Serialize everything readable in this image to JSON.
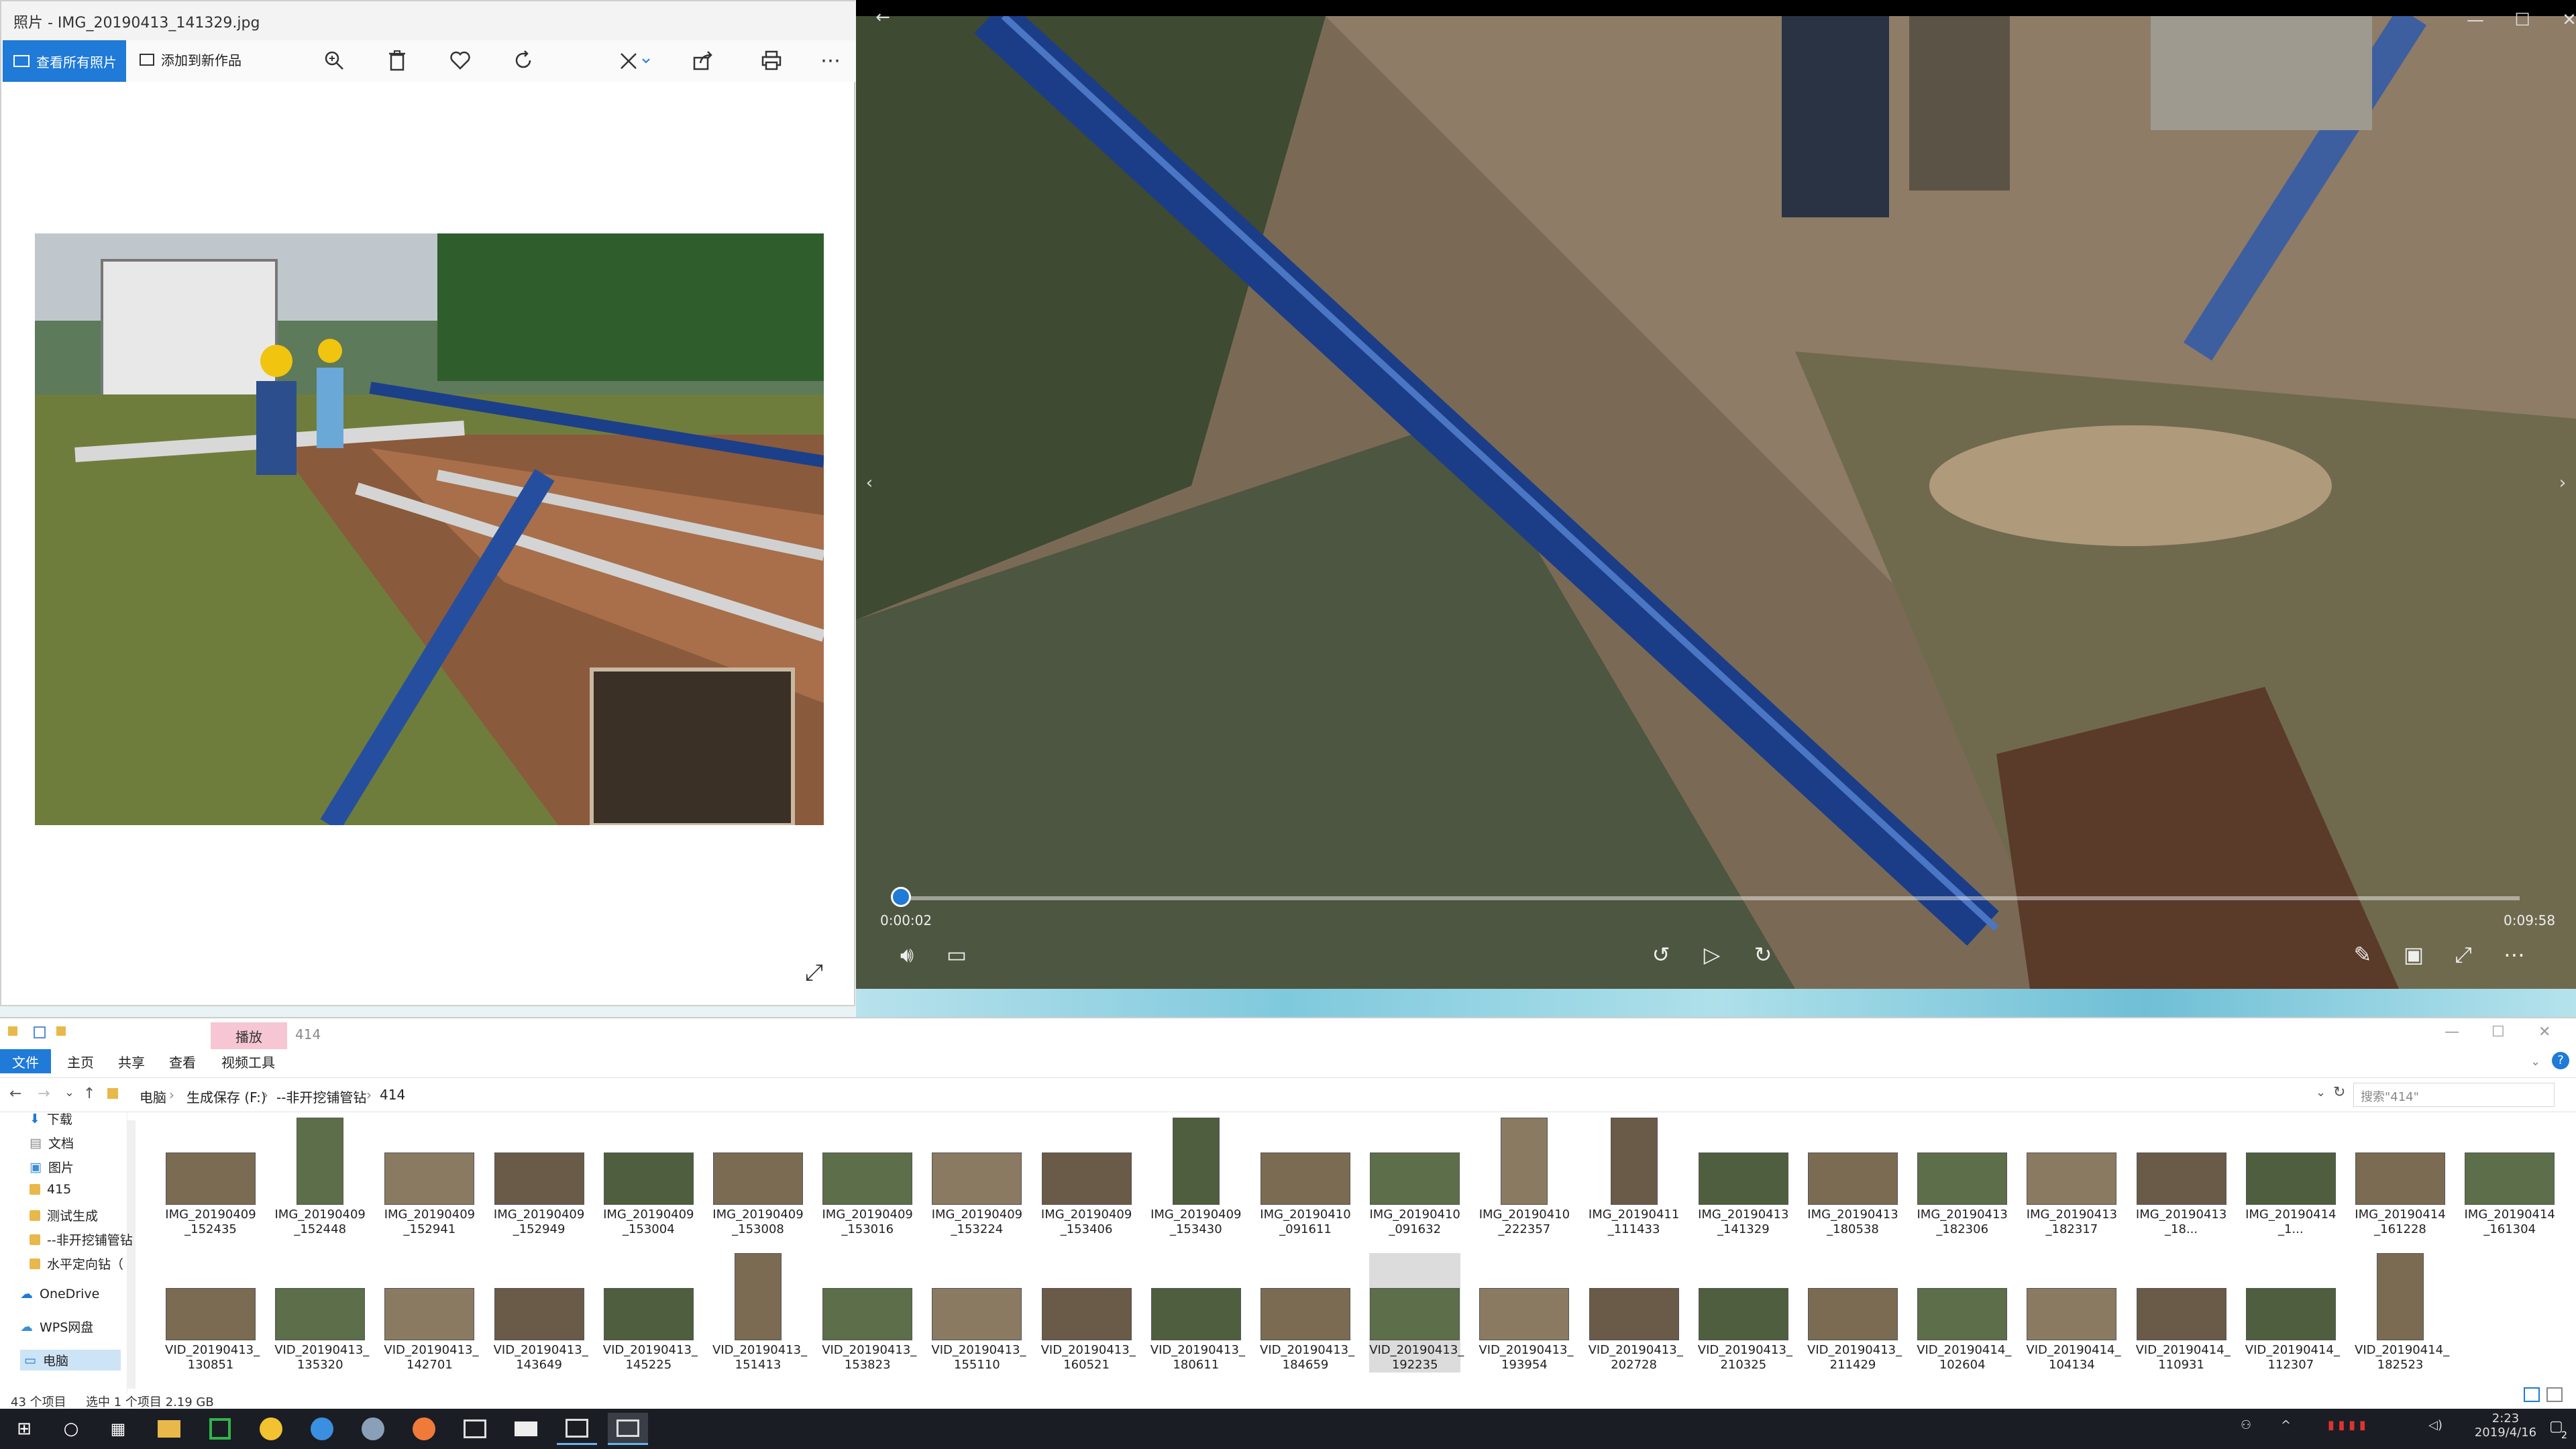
{
  "photos": {
    "title": "照片 - IMG_20190413_141329.jpg",
    "see_all_label": "查看所有照片",
    "add_to_creation_label": "添加到新作品"
  },
  "video": {
    "current_time": "0:00:02",
    "total_time": "0:09:58",
    "progress": 0.003
  },
  "explorer": {
    "context_tab": "播放",
    "folder_title": "414",
    "tabs": [
      "文件",
      "主页",
      "共享",
      "查看",
      "视频工具"
    ],
    "breadcrumb": [
      "电脑",
      "生成保存 (F:)",
      "--非开挖铺管钻",
      "414"
    ],
    "search_placeholder": "搜索\"414\"",
    "nav": {
      "quick": [
        "下载",
        "文档",
        "图片",
        "415",
        "测试生成",
        "--非开挖铺管钻",
        "水平定向钻（"
      ],
      "onedrive": "OneDrive",
      "wps": "WPS网盘",
      "pc": "电脑"
    },
    "row1": [
      {
        "l1": "IMG_20190409",
        "l2": "_152435"
      },
      {
        "l1": "IMG_20190409",
        "l2": "_152448"
      },
      {
        "l1": "IMG_20190409",
        "l2": "_152941"
      },
      {
        "l1": "IMG_20190409",
        "l2": "_152949"
      },
      {
        "l1": "IMG_20190409",
        "l2": "_153004"
      },
      {
        "l1": "IMG_20190409",
        "l2": "_153008"
      },
      {
        "l1": "IMG_20190409",
        "l2": "_153016"
      },
      {
        "l1": "IMG_20190409",
        "l2": "_153224"
      },
      {
        "l1": "IMG_20190409",
        "l2": "_153406"
      },
      {
        "l1": "IMG_20190409",
        "l2": "_153430"
      },
      {
        "l1": "IMG_20190410",
        "l2": "_091611"
      },
      {
        "l1": "IMG_20190410",
        "l2": "_091632"
      },
      {
        "l1": "IMG_20190410",
        "l2": "_222357"
      },
      {
        "l1": "IMG_20190411",
        "l2": "_111433"
      },
      {
        "l1": "IMG_20190413",
        "l2": "_141329"
      },
      {
        "l1": "IMG_20190413",
        "l2": "_180538"
      },
      {
        "l1": "IMG_20190413",
        "l2": "_182306"
      },
      {
        "l1": "IMG_20190413",
        "l2": "_182317"
      },
      {
        "l1": "IMG_20190413",
        "l2": "_18..."
      },
      {
        "l1": "IMG_20190414",
        "l2": "_1..."
      },
      {
        "l1": "IMG_20190414",
        "l2": "_161228"
      },
      {
        "l1": "IMG_20190414",
        "l2": "_161304"
      }
    ],
    "row2": [
      {
        "l1": "VID_20190413_",
        "l2": "130851"
      },
      {
        "l1": "VID_20190413_",
        "l2": "135320"
      },
      {
        "l1": "VID_20190413_",
        "l2": "142701"
      },
      {
        "l1": "VID_20190413_",
        "l2": "143649"
      },
      {
        "l1": "VID_20190413_",
        "l2": "145225"
      },
      {
        "l1": "VID_20190413_",
        "l2": "151413"
      },
      {
        "l1": "VID_20190413_",
        "l2": "153823"
      },
      {
        "l1": "VID_20190413_",
        "l2": "155110"
      },
      {
        "l1": "VID_20190413_",
        "l2": "160521"
      },
      {
        "l1": "VID_20190413_",
        "l2": "180611"
      },
      {
        "l1": "VID_20190413_",
        "l2": "184659"
      },
      {
        "l1": "VID_20190413_",
        "l2": "192235"
      },
      {
        "l1": "VID_20190413_",
        "l2": "193954"
      },
      {
        "l1": "VID_20190413_",
        "l2": "202728"
      },
      {
        "l1": "VID_20190413_",
        "l2": "210325"
      },
      {
        "l1": "VID_20190413_",
        "l2": "211429"
      },
      {
        "l1": "VID_20190414_",
        "l2": "102604"
      },
      {
        "l1": "VID_20190414_",
        "l2": "104134"
      },
      {
        "l1": "VID_20190414_",
        "l2": "110931"
      },
      {
        "l1": "VID_20190414_",
        "l2": "112307"
      },
      {
        "l1": "VID_20190414_",
        "l2": "182523"
      }
    ],
    "status_count": "43 个项目",
    "status_selection": "选中 1 个项目  2.19 GB"
  },
  "taskbar": {
    "time": "2:23",
    "date": "2019/4/16",
    "notif_count": "2"
  },
  "colors": {
    "accent": "#1f7ad8",
    "context_tab": "#f6c6d4",
    "taskbar": "#1a1e24"
  }
}
